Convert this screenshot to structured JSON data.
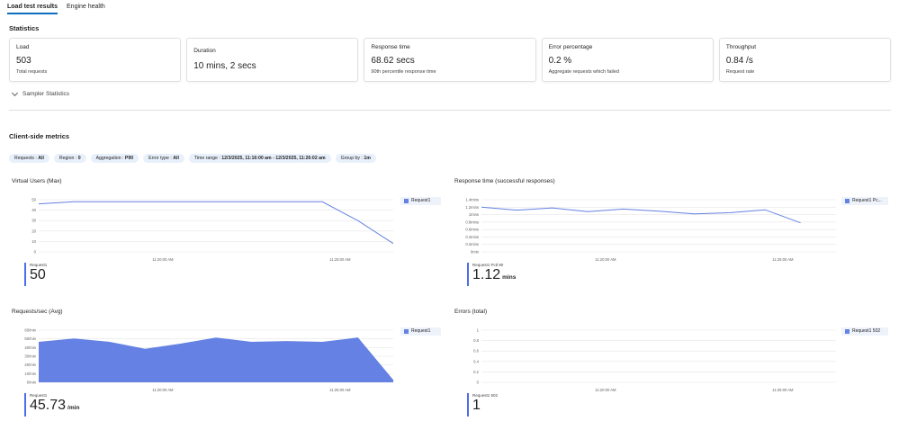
{
  "tabs": [
    {
      "label": "Load test results",
      "active": true
    },
    {
      "label": "Engine health",
      "active": false
    }
  ],
  "statistics": {
    "title": "Statistics",
    "cards": [
      {
        "label": "Load",
        "value": "503",
        "sub": "Total requests"
      },
      {
        "label": "Duration",
        "value": "10 mins, 2 secs",
        "sub": ""
      },
      {
        "label": "Response time",
        "value": "68.62 secs",
        "sub": "90th percentile response time"
      },
      {
        "label": "Error percentage",
        "value": "0.2 %",
        "sub": "Aggregate requests which failed"
      },
      {
        "label": "Throughput",
        "value": "0.84 /s",
        "sub": "Request rate"
      }
    ],
    "sampler_label": "Sampler Statistics"
  },
  "client_metrics": {
    "title": "Client-side metrics",
    "filters": [
      {
        "key": "Requests :",
        "value": "All"
      },
      {
        "key": "Region :",
        "value": "0"
      },
      {
        "key": "Aggregation :",
        "value": "P90"
      },
      {
        "key": "Error type :",
        "value": "All"
      },
      {
        "key": "Time range :",
        "value": "12/3/2025, 11:16:00 am - 12/3/2025, 11:26:02 am"
      },
      {
        "key": "Group by :",
        "value": "1m"
      }
    ]
  },
  "colors": {
    "accent": "#4f6bed",
    "series": "#6481e3",
    "pill_bg": "#e8f0fb"
  },
  "chart_data": [
    {
      "type": "line",
      "title": "Virtual Users (Max)",
      "x": [
        0,
        1,
        2,
        3,
        4,
        5,
        6,
        7,
        8,
        9,
        10
      ],
      "x_ticks": [
        {
          "x": 3.5,
          "label": "11:20:00 AM"
        },
        {
          "x": 8.5,
          "label": "11:25:00 AM"
        }
      ],
      "y_ticks": [
        "0",
        "10",
        "20",
        "30",
        "40",
        "50"
      ],
      "ylim": [
        0,
        50
      ],
      "series": [
        {
          "name": "Request1",
          "values": [
            46,
            48,
            48,
            48,
            48,
            48,
            48,
            48,
            48,
            30,
            8
          ]
        }
      ],
      "summary": {
        "label": "Request1",
        "value": "50",
        "unit": ""
      }
    },
    {
      "type": "line",
      "title": "Response time (successful responses)",
      "x": [
        0,
        1,
        2,
        3,
        4,
        5,
        6,
        7,
        8,
        9,
        10
      ],
      "x_ticks": [
        {
          "x": 3.5,
          "label": "11:20:00 AM"
        },
        {
          "x": 8.5,
          "label": "11:25:00 AM"
        }
      ],
      "y_ticks": [
        "0min",
        "0.2mins",
        "0.4mins",
        "0.6mins",
        "0.8mins",
        "1mins",
        "1.2mins",
        "1.4mins"
      ],
      "ylim": [
        0,
        1.4
      ],
      "series": [
        {
          "name": "Request1 Pc...",
          "values": [
            1.2,
            1.12,
            1.18,
            1.08,
            1.15,
            1.09,
            1.02,
            1.05,
            1.13,
            0.78
          ]
        }
      ],
      "summary": {
        "label": "Request1 Pctl 90",
        "value": "1.12",
        "unit": "mins"
      }
    },
    {
      "type": "area",
      "title": "Requests/sec (Avg)",
      "x": [
        0,
        1,
        2,
        3,
        4,
        5,
        6,
        7,
        8,
        9,
        10
      ],
      "x_ticks": [
        {
          "x": 3.5,
          "label": "11:20:00 AM"
        },
        {
          "x": 8.5,
          "label": "11:25:00 AM"
        }
      ],
      "y_ticks": [
        "0/min",
        "10/min",
        "20/min",
        "30/min",
        "40/min",
        "50/min",
        "60/min"
      ],
      "ylim": [
        0,
        60
      ],
      "series": [
        {
          "name": "Request1",
          "values": [
            46,
            50,
            46,
            38,
            44,
            51,
            46,
            47,
            46,
            51,
            2
          ]
        }
      ],
      "summary": {
        "label": "Request1",
        "value": "45.73",
        "unit": "/min"
      }
    },
    {
      "type": "line",
      "title": "Errors (total)",
      "x": [
        0,
        1,
        2,
        3,
        4,
        5,
        6,
        7,
        8,
        9,
        10
      ],
      "x_ticks": [
        {
          "x": 3.5,
          "label": "11:20:00 AM"
        },
        {
          "x": 8.5,
          "label": "11:25:00 AM"
        }
      ],
      "y_ticks": [
        "0",
        "0.2",
        "0.4",
        "0.6",
        "0.8",
        "1"
      ],
      "ylim": [
        0,
        1
      ],
      "series": [
        {
          "name": "Request1 502",
          "values": []
        }
      ],
      "summary": {
        "label": "Request1 502",
        "value": "1",
        "unit": ""
      }
    }
  ]
}
